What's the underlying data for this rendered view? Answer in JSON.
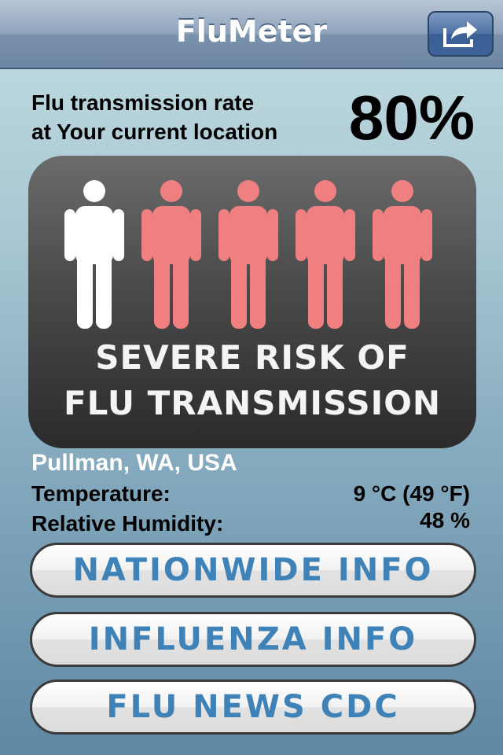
{
  "navbar": {
    "title": "FluMeter",
    "share_icon": "share-arrow-icon"
  },
  "rate": {
    "label_line1": "Flu transmission rate",
    "label_line2": "at Your current location",
    "value": "80%"
  },
  "risk": {
    "people": [
      {
        "color": "#ffffff",
        "infected": false
      },
      {
        "color": "#f08080",
        "infected": true
      },
      {
        "color": "#f08080",
        "infected": true
      },
      {
        "color": "#f08080",
        "infected": true
      },
      {
        "color": "#f08080",
        "infected": true
      }
    ],
    "line1": "SEVERE RISK OF",
    "line2": "FLU TRANSMISSION"
  },
  "weather": {
    "location": "Pullman, WA, USA",
    "temperature_label": "Temperature:",
    "temperature_value": "9 °C (49 °F)",
    "humidity_label": "Relative Humidity:",
    "humidity_value": "48 %"
  },
  "buttons": {
    "nationwide": "NATIONWIDE INFO",
    "influenza": "INFLUENZA INFO",
    "news": "FLU NEWS CDC"
  },
  "colors": {
    "accent": "#3f82b8",
    "infected": "#f08080",
    "healthy": "#ffffff"
  }
}
